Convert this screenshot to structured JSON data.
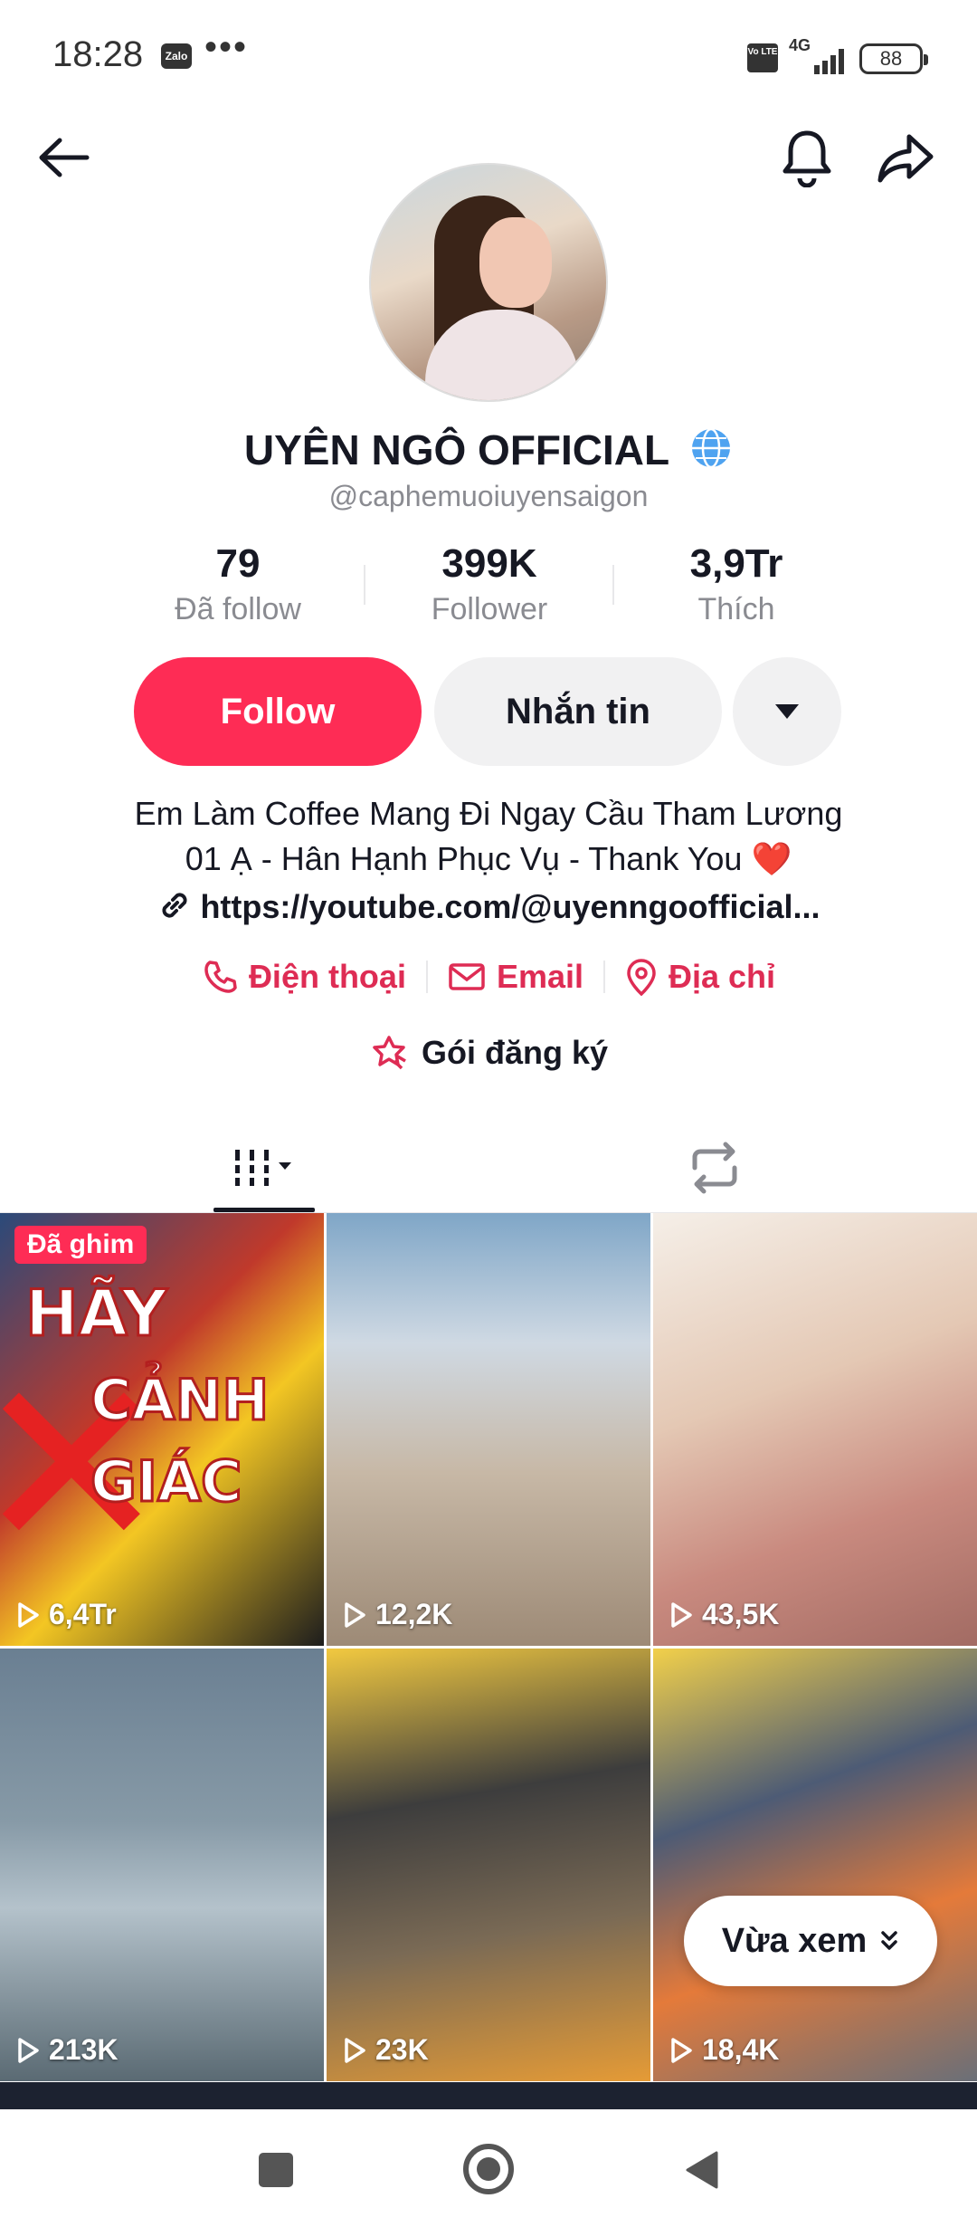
{
  "status_bar": {
    "time": "18:28",
    "zalo": "Zalo",
    "dots": "•••",
    "volte": "Vo LTE",
    "network": "4G",
    "battery": "88"
  },
  "profile": {
    "display_name": "UYÊN NGÔ OFFICIAL",
    "username": "@caphemuoiuyensaigon",
    "stats": {
      "following_count": "79",
      "following_label": "Đã follow",
      "followers_count": "399K",
      "followers_label": "Follower",
      "likes_count": "3,9Tr",
      "likes_label": "Thích"
    },
    "buttons": {
      "follow": "Follow",
      "message": "Nhắn tin"
    },
    "bio_line1": "Em Làm Coffee Mang Đi Ngay Cầu Tham Lương",
    "bio_line2": "01 Ạ - Hân Hạnh Phục Vụ - Thank You",
    "bio_emoji": "❤️",
    "link": "https://youtube.com/@uyenngoofficial...",
    "contacts": {
      "phone": "Điện thoại",
      "email": "Email",
      "address": "Địa chỉ"
    },
    "subscription": "Gói đăng ký"
  },
  "videos": [
    {
      "views": "6,4Tr",
      "pinned": "Đã ghim",
      "overlay_text": [
        "HÃY",
        "CẢNH",
        "GIÁC"
      ]
    },
    {
      "views": "12,2K"
    },
    {
      "views": "43,5K"
    },
    {
      "views": "213K"
    },
    {
      "views": "23K"
    },
    {
      "views": "18,4K"
    }
  ],
  "recently_watched": "Vừa xem",
  "colors": {
    "accent": "#fe2c55",
    "contact": "#de2c54",
    "text": "#161823",
    "muted": "#8a8b91"
  }
}
